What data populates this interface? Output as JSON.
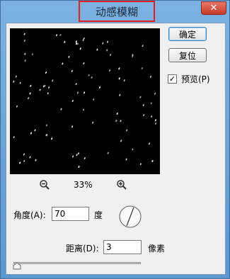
{
  "window": {
    "title": "动感模糊",
    "close_glyph": "✕"
  },
  "buttons": {
    "ok": "确定",
    "reset": "复位"
  },
  "preview_toggle": {
    "label": "预览(P)",
    "checked": true,
    "check_glyph": "✓"
  },
  "zoom": {
    "level": "33%",
    "zoom_out_icon": "zoom-out-icon",
    "zoom_in_icon": "zoom-in-icon"
  },
  "angle": {
    "label": "角度(A):",
    "value": "70",
    "unit": "度"
  },
  "distance": {
    "label": "距离(D):",
    "value": "3",
    "unit": "像素"
  },
  "slider": {
    "level": 0
  },
  "colors": {
    "title_highlight": "#e02020",
    "preview_bg": "#000000"
  }
}
